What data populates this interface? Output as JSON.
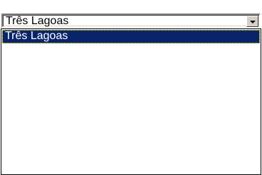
{
  "combo": {
    "value": "Três Lagoas",
    "button_icon": "chevron-down-icon"
  },
  "list": {
    "items": [
      {
        "label": "Três Lagoas",
        "selected": true
      }
    ]
  },
  "colors": {
    "selection_bg": "#0a246a",
    "selection_text": "#ffffff",
    "control_face": "#d4d0c8"
  }
}
